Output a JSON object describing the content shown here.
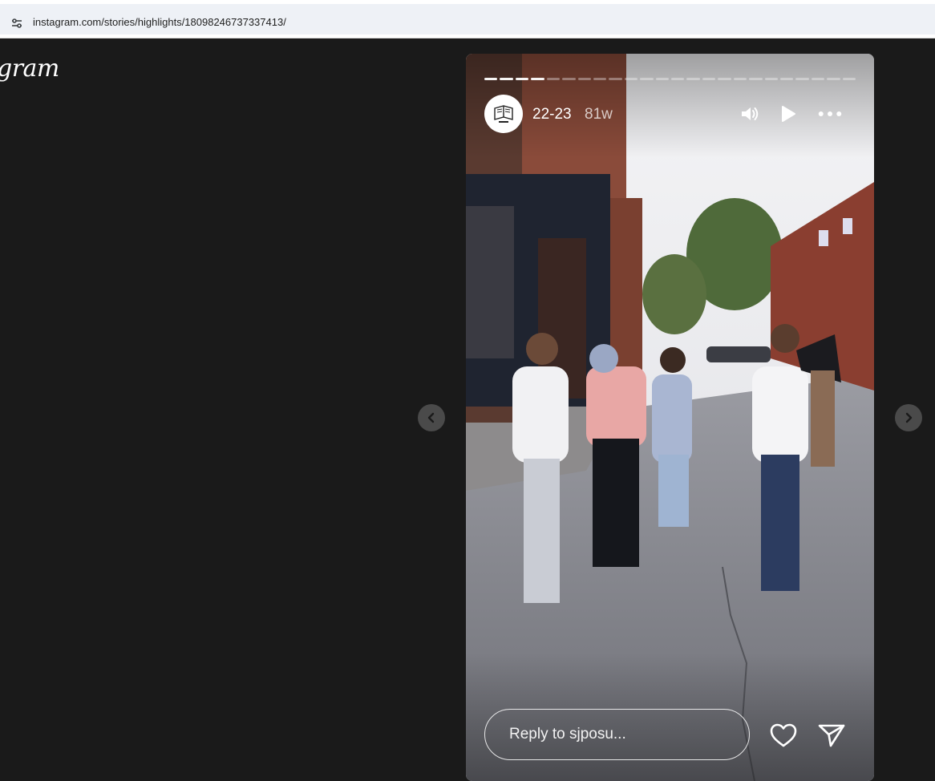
{
  "browser": {
    "url": "instagram.com/stories/highlights/18098246737337413/",
    "site_settings_icon": "tune-icon"
  },
  "header": {
    "logo_text": "gram"
  },
  "story": {
    "progress": {
      "total_segments": 24,
      "completed_segments": 4
    },
    "avatar_icon": "book-logo-icon",
    "title": "22-23",
    "age": "81w",
    "controls": {
      "sound_icon": "speaker-icon",
      "play_icon": "play-icon",
      "more_icon": "more-horizontal-icon"
    },
    "reply_placeholder": "Reply to sjposu...",
    "actions": {
      "like_icon": "heart-icon",
      "share_icon": "send-icon"
    }
  },
  "navigation": {
    "prev_icon": "chevron-left-icon",
    "next_icon": "chevron-right-icon"
  }
}
